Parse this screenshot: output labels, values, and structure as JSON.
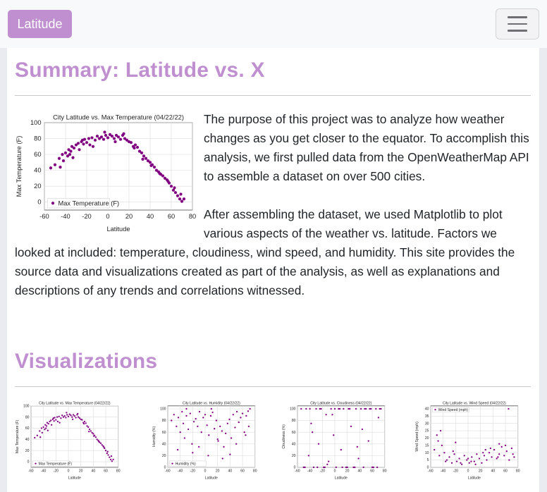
{
  "navbar": {
    "brand": "Latitude",
    "menu_icon": "hamburger-icon"
  },
  "colors": {
    "accent": "#bf8fd0",
    "marker": "#800080"
  },
  "summary": {
    "heading": "Summary: Latitude vs. X",
    "paragraph_1": "The purpose of this project was to analyze how weather changes as you get closer to the equator. To accomplish this analysis, we first pulled data from the OpenWeatherMap API to assemble a dataset on over 500 cities.",
    "paragraph_2": "After assembling the dataset, we used Matplotlib to plot various aspects of the weather vs. latitude. Factors we looked at included: temperature, cloudiness, wind speed, and humidity. This site provides the source data and visualizations created as part of the analysis, as well as explanations and descriptions of any trends and correlations witnessed."
  },
  "visualizations": {
    "heading": "Visualizations"
  },
  "chart_data": [
    {
      "type": "scatter",
      "title": "City Latitude vs. Max Temperature (04/22/22)",
      "xlabel": "Latitude",
      "ylabel": "Max Temperature (F)",
      "legend": "Max Temperature (F)",
      "legend_position": "bottom-left",
      "xlim": [
        -60,
        80
      ],
      "ylim": [
        -10,
        100
      ],
      "xticks": [
        -60,
        -40,
        -20,
        0,
        20,
        40,
        60,
        80
      ],
      "yticks": [
        0,
        20,
        40,
        60,
        80,
        100
      ],
      "grid": true,
      "x": [
        -54,
        -50,
        -46,
        -43,
        -42,
        -40,
        -38,
        -37,
        -35,
        -34,
        -33,
        -32,
        -30,
        -28,
        -27,
        -25,
        -23,
        -22,
        -20,
        -18,
        -17,
        -15,
        -12,
        -10,
        -8,
        -6,
        -4,
        -2,
        0,
        2,
        4,
        6,
        8,
        10,
        12,
        14,
        16,
        18,
        20,
        22,
        24,
        26,
        28,
        30,
        32,
        34,
        36,
        38,
        40,
        42,
        44,
        46,
        48,
        50,
        52,
        54,
        56,
        58,
        60,
        62,
        64,
        66,
        68,
        70,
        -45,
        -36,
        -24,
        -14,
        -3,
        7,
        15,
        25,
        33,
        41,
        49,
        57,
        63,
        69,
        72
      ],
      "y": [
        43,
        47,
        55,
        60,
        52,
        62,
        58,
        66,
        64,
        70,
        56,
        68,
        72,
        74,
        66,
        76,
        73,
        79,
        75,
        80,
        72,
        81,
        78,
        83,
        80,
        82,
        79,
        84,
        81,
        85,
        83,
        80,
        84,
        82,
        79,
        84,
        80,
        78,
        76,
        75,
        70,
        72,
        69,
        64,
        62,
        58,
        55,
        52,
        50,
        47,
        44,
        40,
        38,
        35,
        33,
        30,
        28,
        24,
        20,
        15,
        12,
        8,
        4,
        1,
        44,
        60,
        78,
        70,
        88,
        76,
        86,
        68,
        54,
        46,
        36,
        26,
        18,
        10,
        4
      ]
    },
    {
      "type": "scatter",
      "title": "City Latitude vs. Humidity (04/22/22)",
      "xlabel": "Latitude",
      "ylabel": "Humidity (%)",
      "legend": "Humidity (%)",
      "legend_position": "bottom-left",
      "xlim": [
        -60,
        80
      ],
      "ylim": [
        0,
        105
      ],
      "xticks": [
        -60,
        -40,
        -20,
        0,
        20,
        40,
        60,
        80
      ],
      "yticks": [
        0,
        20,
        40,
        60,
        80,
        100
      ],
      "grid": true,
      "x": [
        -54,
        -50,
        -46,
        -43,
        -40,
        -37,
        -35,
        -33,
        -30,
        -27,
        -24,
        -21,
        -18,
        -15,
        -12,
        -9,
        -6,
        -3,
        0,
        3,
        6,
        9,
        12,
        15,
        18,
        21,
        24,
        27,
        30,
        33,
        36,
        39,
        42,
        45,
        48,
        51,
        54,
        57,
        60,
        63,
        66,
        69,
        72,
        -44,
        -20,
        5,
        28,
        50,
        65,
        -30,
        10,
        40,
        70,
        -10,
        20
      ],
      "y": [
        80,
        90,
        70,
        85,
        60,
        95,
        75,
        50,
        88,
        65,
        92,
        40,
        78,
        83,
        70,
        95,
        60,
        85,
        90,
        72,
        55,
        88,
        94,
        66,
        80,
        45,
        70,
        62,
        35,
        58,
        75,
        82,
        50,
        90,
        68,
        95,
        77,
        85,
        92,
        60,
        88,
        96,
        100,
        30,
        25,
        20,
        15,
        40,
        55,
        100,
        100,
        22,
        70,
        35,
        48
      ]
    },
    {
      "type": "scatter",
      "title": "City Latitude vs. Cloudiness (04/22/22)",
      "xlabel": "Latitude",
      "ylabel": "Cloudiness (%)",
      "legend": "",
      "legend_position": "",
      "xlim": [
        -60,
        80
      ],
      "ylim": [
        0,
        105
      ],
      "xticks": [
        -60,
        -40,
        -20,
        0,
        20,
        40,
        60,
        80
      ],
      "yticks": [
        0,
        20,
        40,
        60,
        80,
        100
      ],
      "grid": true,
      "x": [
        -54,
        -50,
        -46,
        -42,
        -38,
        -34,
        -30,
        -26,
        -22,
        -18,
        -14,
        -10,
        -6,
        -2,
        2,
        6,
        10,
        14,
        18,
        22,
        26,
        30,
        34,
        38,
        42,
        46,
        50,
        54,
        58,
        62,
        66,
        70,
        74,
        -48,
        -36,
        -24,
        -12,
        0,
        12,
        24,
        36,
        48,
        60,
        72,
        -40,
        -16,
        8,
        32,
        56,
        -28,
        -4,
        20,
        44,
        68
      ],
      "y": [
        100,
        0,
        100,
        20,
        75,
        0,
        100,
        40,
        100,
        0,
        90,
        10,
        100,
        55,
        0,
        100,
        30,
        100,
        0,
        100,
        70,
        0,
        100,
        15,
        100,
        0,
        100,
        45,
        100,
        0,
        100,
        85,
        100,
        0,
        60,
        100,
        5,
        100,
        0,
        100,
        35,
        100,
        0,
        100,
        100,
        0,
        100,
        0,
        100,
        0,
        90,
        0,
        65,
        0
      ]
    },
    {
      "type": "scatter",
      "title": "City Latitude vs. Wind Speed (04/22/22)",
      "xlabel": "Latitude",
      "ylabel": "Wind Speed (mph)",
      "legend": "Wind Speed (mph)",
      "legend_position": "top-left",
      "xlim": [
        -60,
        80
      ],
      "ylim": [
        0,
        42
      ],
      "xticks": [
        -60,
        -40,
        -20,
        0,
        20,
        40,
        60,
        80
      ],
      "yticks": [
        0,
        5,
        10,
        15,
        20,
        25,
        30,
        35,
        40
      ],
      "grid": true,
      "x": [
        -54,
        -50,
        -46,
        -42,
        -38,
        -34,
        -30,
        -26,
        -22,
        -18,
        -14,
        -10,
        -6,
        -2,
        2,
        6,
        10,
        14,
        18,
        22,
        26,
        30,
        34,
        38,
        42,
        46,
        50,
        54,
        58,
        62,
        66,
        70,
        74,
        -48,
        -36,
        -24,
        -12,
        0,
        12,
        24,
        36,
        48,
        60,
        72,
        -44,
        -20,
        5,
        28,
        50,
        65
      ],
      "y": [
        12,
        22,
        8,
        15,
        10,
        5,
        7,
        3,
        9,
        4,
        6,
        2,
        8,
        5,
        3,
        7,
        4,
        9,
        6,
        3,
        8,
        5,
        10,
        7,
        12,
        6,
        9,
        14,
        8,
        11,
        5,
        13,
        7,
        18,
        4,
        11,
        3,
        6,
        2,
        10,
        13,
        7,
        15,
        9,
        25,
        17,
        4,
        12,
        16,
        40
      ]
    }
  ]
}
